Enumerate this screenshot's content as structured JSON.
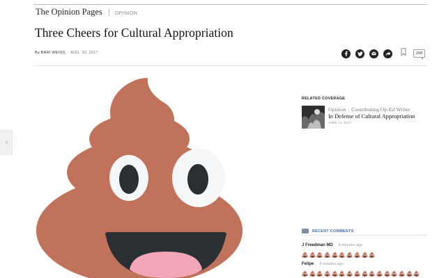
{
  "masthead": {
    "section_name": "The Opinion Pages",
    "section_kicker": "OPINION"
  },
  "article": {
    "headline": "Three Cheers for Cultural Appropriation",
    "byline": "By BARI WEISS",
    "date": "AUG. 30, 2017"
  },
  "share": {
    "icons": [
      "facebook-icon",
      "twitter-icon",
      "email-icon",
      "share-arrow-icon",
      "bookmark-icon"
    ],
    "comment_count": "268"
  },
  "media": {
    "image": "pile-of-poo-emoji",
    "colors": {
      "body": "#c1725a",
      "eye_white": "#f4f6f8",
      "pupil": "#292f33",
      "mouth": "#292f33",
      "tongue": "#f1a7b5"
    }
  },
  "related": {
    "title": "RELATED COVERAGE",
    "kicker": "Opinion",
    "kicker_sub": "Contributing Op-Ed Writer",
    "headline": "In Defense of Cultural Appropriation",
    "date": "JUNE 14, 2017"
  },
  "recent_comments": {
    "title": "RECENT COMMENTS",
    "comments": [
      {
        "author": "J Freedman MD",
        "time": "4 minutes ago",
        "emoji_count": 10
      },
      {
        "author": "Felipe",
        "time": "4 minutes ago",
        "emoji_count": 16
      }
    ]
  }
}
